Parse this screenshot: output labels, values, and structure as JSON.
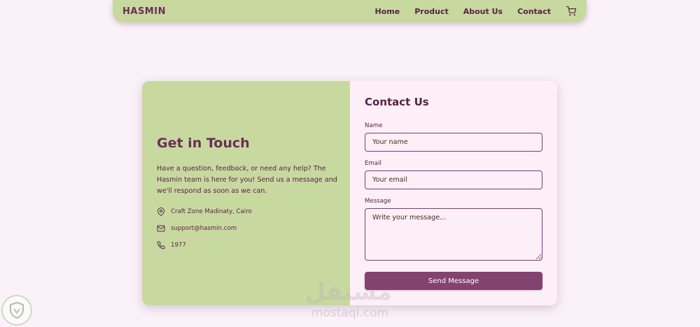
{
  "navbar": {
    "brand": "HASMIN",
    "links": [
      {
        "label": "Home"
      },
      {
        "label": "Product"
      },
      {
        "label": "About Us"
      },
      {
        "label": "Contact"
      }
    ],
    "cart_icon": "cart-icon"
  },
  "get_in_touch": {
    "title": "Get in Touch",
    "description": "Have a question, feedback, or need any help? The Hasmin team is here for you! Send us a message and we'll respond as soon as we can.",
    "address": "Craft Zone Madinaty, Cairo",
    "email": "support@hasmin.com",
    "phone": "1977"
  },
  "contact_form": {
    "title": "Contact Us",
    "name_label": "Name",
    "name_placeholder": "Your name",
    "email_label": "Email",
    "email_placeholder": "Your email",
    "message_label": "Message",
    "message_placeholder": "Write your message...",
    "submit_label": "Send Message"
  },
  "watermark": {
    "arabic": "مستقل",
    "site": "mostaql.com"
  },
  "colors": {
    "page_bg": "#fbf1f8",
    "green": "#c8d99f",
    "plum": "#844270",
    "text": "#5a2148"
  }
}
